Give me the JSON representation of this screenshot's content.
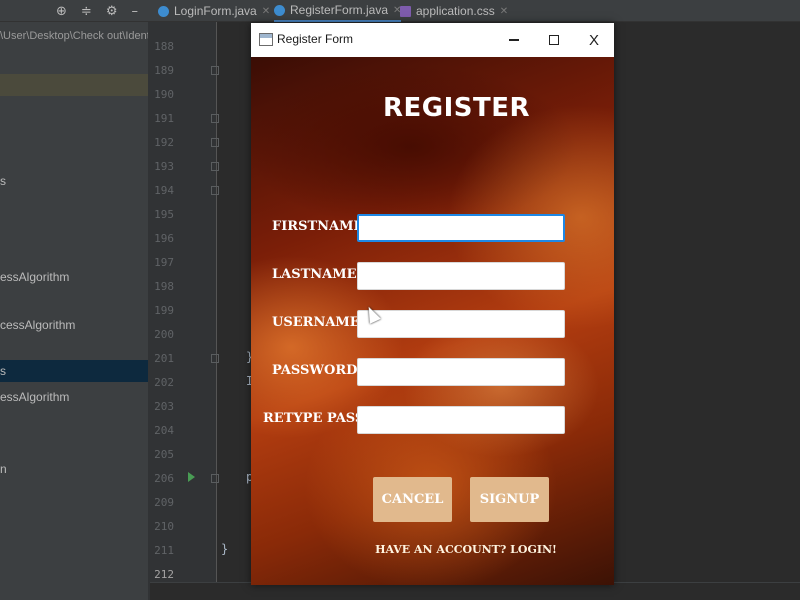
{
  "ide": {
    "tabs": [
      {
        "label": "LoginForm.java"
      },
      {
        "label": "RegisterForm.java"
      },
      {
        "label": "application.css"
      }
    ],
    "toolbar_icons": [
      "crosshair-icon",
      "split-icon",
      "gear-icon",
      "minimize-icon"
    ],
    "project_path": "\\User\\Desktop\\Check out\\Ident",
    "tree_items": [
      {
        "label": "s"
      },
      {
        "label": "essAlgorithm"
      },
      {
        "label": "cessAlgorithm"
      },
      {
        "label": "s"
      },
      {
        "label": "essAlgorithm"
      },
      {
        "label": "n"
      }
    ],
    "line_numbers": [
      "188",
      "189",
      "190",
      "191",
      "192",
      "193",
      "194",
      "195",
      "196",
      "197",
      "198",
      "199",
      "200",
      "201",
      "202",
      "203",
      "204",
      "205",
      "206",
      "209",
      "210",
      "211",
      "212"
    ],
    "code_fragments": [
      "}",
      "I",
      "p",
      "}"
    ]
  },
  "window": {
    "title": "Register Form",
    "minimize_label": "–",
    "close_label": "X"
  },
  "form": {
    "heading": "REGISTER",
    "fields": [
      {
        "label": "FIRSTNAME:",
        "value": "",
        "focused": true
      },
      {
        "label": "LASTNAME:",
        "value": ""
      },
      {
        "label": "USERNAME:",
        "value": ""
      },
      {
        "label": "PASSWORD:",
        "value": ""
      },
      {
        "label": "RETYPE PASS:",
        "value": ""
      }
    ],
    "cancel_label": "CANCEL",
    "signup_label": "SIGNUP",
    "login_link": "HAVE AN ACCOUNT? LOGIN!",
    "button_color": "#e1b98d"
  }
}
